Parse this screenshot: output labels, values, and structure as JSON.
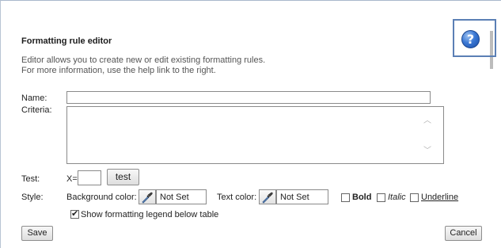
{
  "dialog": {
    "title": "Formatting rule editor",
    "description_line1": "Editor allows you to create new or edit existing formatting rules.",
    "description_line2": "For more information, use the help link to the right.",
    "help_icon_glyph": "?"
  },
  "form": {
    "name_label": "Name:",
    "name_value": "",
    "criteria_label": "Criteria:",
    "criteria_value": "",
    "test_label": "Test:",
    "test_prefix": "X=",
    "test_value": "",
    "test_button": "test",
    "style_label": "Style:",
    "background_color_label": "Background color:",
    "background_color_value": "Not Set",
    "text_color_label": "Text color:",
    "text_color_value": "Not Set",
    "bold_label": "Bold",
    "bold_checked": false,
    "italic_label": "Italic",
    "italic_checked": false,
    "underline_label": "Underline",
    "underline_checked": false,
    "legend_label": "Show formatting legend below table",
    "legend_checked": true
  },
  "buttons": {
    "save": "Save",
    "cancel": "Cancel"
  },
  "colors": {
    "help_highlight": "#5b7fb5",
    "help_icon": "#3b78d4"
  },
  "icons": {
    "help": "question-circle-icon",
    "color_picker": "eyedropper-icon",
    "scroll_up": "chevron-up-icon",
    "scroll_down": "chevron-down-icon"
  }
}
